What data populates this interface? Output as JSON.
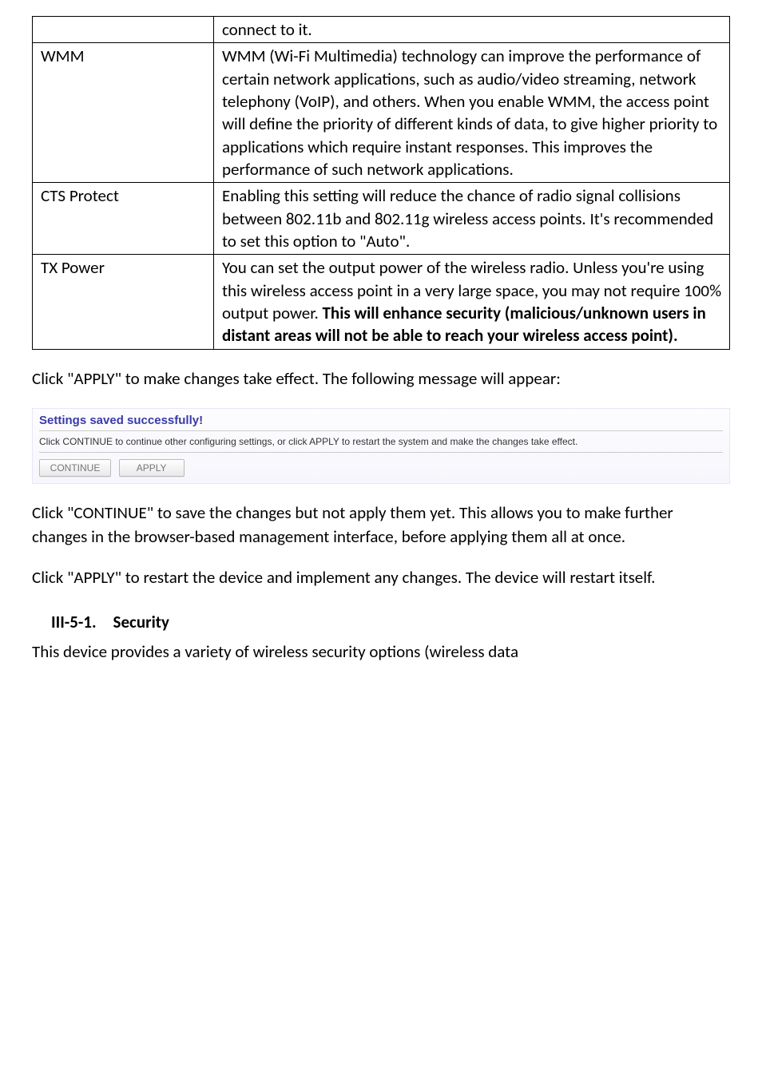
{
  "table": {
    "r0c1": "connect to it.",
    "r1c0": "WMM",
    "r1c1": "WMM (Wi-Fi Multimedia) technology can improve the performance of certain network applications, such as audio/video streaming, network telephony (VoIP), and others. When you enable WMM, the access point will define the priority of different kinds of data, to give higher priority to applications which require instant responses. This improves the performance of such network applications.",
    "r2c0": "CTS Protect",
    "r2c1": "Enabling this setting will reduce the chance of radio signal collisions between 802.11b and 802.11g wireless access points. It's recommended to set this option to \"Auto\".",
    "r3c0": "TX Power",
    "r3c1_plain": "You can set the output power of the wireless radio. Unless you're using this wireless access point in a very large space, you may not require 100% output power. ",
    "r3c1_bold": "This will enhance security (malicious/unknown users in distant areas will not be able to reach your wireless access point)."
  },
  "p1": "Click \"APPLY\" to make changes take effect. The following message will appear:",
  "panel": {
    "title": "Settings saved successfully!",
    "msg": "Click CONTINUE to continue other configuring settings, or click APPLY to restart the system and make the changes take effect.",
    "continue": "CONTINUE",
    "apply": "APPLY"
  },
  "p2": "Click \"CONTINUE\" to save the changes but not apply them yet. This allows you to make further changes in the browser-based management interface, before applying them all at once.",
  "p3": "Click \"APPLY\" to restart the device and implement any changes. The device will restart itself.",
  "heading": "III-5-1. Security",
  "p4": "This device provides a variety of wireless security options (wireless data"
}
